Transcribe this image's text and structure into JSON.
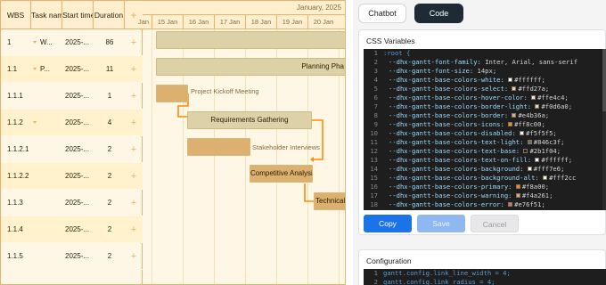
{
  "gantt": {
    "month_label": "January, 2025",
    "columns": {
      "wbs": "WBS",
      "task": "Task name",
      "start": "Start time",
      "duration": "Duration",
      "add": "+"
    },
    "days": [
      "Jan",
      "15 Jan",
      "16 Jan",
      "17 Jan",
      "18 Jan",
      "19 Jan",
      "20 Jan"
    ],
    "rows": [
      {
        "wbs": "1",
        "task": "W...",
        "start": "2025-...",
        "duration": "86",
        "caret": true
      },
      {
        "wbs": "1.1",
        "task": "P...",
        "start": "2025-...",
        "duration": "11",
        "caret": true
      },
      {
        "wbs": "1.1.1",
        "task": "",
        "start": "2025-...",
        "duration": "1",
        "caret": false
      },
      {
        "wbs": "1.1.2",
        "task": "",
        "start": "2025-...",
        "duration": "4",
        "caret": true
      },
      {
        "wbs": "1.1.2.1",
        "task": "",
        "start": "2025-...",
        "duration": "2",
        "caret": false
      },
      {
        "wbs": "1.1.2.2",
        "task": "",
        "start": "2025-...",
        "duration": "2",
        "caret": false
      },
      {
        "wbs": "1.1.3",
        "task": "",
        "start": "2025-...",
        "duration": "2",
        "caret": false
      },
      {
        "wbs": "1.1.4",
        "task": "",
        "start": "2025-...",
        "duration": "2",
        "caret": false
      },
      {
        "wbs": "1.1.5",
        "task": "",
        "start": "2025-...",
        "duration": "2",
        "caret": false
      }
    ],
    "bars": {
      "planning": "Planning Pha",
      "kickoff": "Project Kickoff Meeting",
      "requirements": "Requirements Gathering",
      "interviews": "Stakeholder Interviews",
      "competitive": "Competitive Analysis",
      "technical": "Technical A"
    }
  },
  "panel": {
    "tabs": {
      "chatbot": "Chatbot",
      "code": "Code"
    },
    "css_title": "CSS Variables",
    "config_title": "Configuration",
    "buttons": {
      "copy": "Copy",
      "save": "Save",
      "cancel": "Cancel"
    },
    "css_lines": [
      {
        "n": "1",
        "text": ":root {"
      },
      {
        "n": "2",
        "prop": "--dhx-gantt-font-family:",
        "val": "Inter, Arial, sans-serif"
      },
      {
        "n": "3",
        "prop": "--dhx-gantt-font-size:",
        "val": "14px;"
      },
      {
        "n": "4",
        "prop": "--dhx-gantt-base-colors-white:",
        "val": "#ffffff;",
        "color": "#ffffff"
      },
      {
        "n": "5",
        "prop": "--dhx-gantt-base-colors-select:",
        "val": "#ffd27a;",
        "color": "#ffd27a"
      },
      {
        "n": "6",
        "prop": "--dhx-gantt-base-colors-hover-color:",
        "val": "#ffe4c4;",
        "color": "#ffe4c4"
      },
      {
        "n": "7",
        "prop": "--dhx-gantt-base-colors-border-light:",
        "val": "#f0d6a0;",
        "color": "#f0d6a0"
      },
      {
        "n": "8",
        "prop": "--dhx-gantt-base-colors-border:",
        "val": "#e4b36a;",
        "color": "#e4b36a"
      },
      {
        "n": "9",
        "prop": "--dhx-gantt-base-colors-icons:",
        "val": "#ff8c00;",
        "color": "#ff8c00"
      },
      {
        "n": "10",
        "prop": "--dhx-gantt-base-colors-disabled:",
        "val": "#f5f5f5;",
        "color": "#f5f5f5"
      },
      {
        "n": "11",
        "prop": "--dhx-gantt-base-colors-text-light:",
        "val": "#846c3f;",
        "color": "#846c3f"
      },
      {
        "n": "12",
        "prop": "--dhx-gantt-base-colors-text-base:",
        "val": "#2b1f04;",
        "color": "#2b1f04"
      },
      {
        "n": "13",
        "prop": "--dhx-gantt-base-colors-text-on-fill:",
        "val": "#ffffff;",
        "color": "#ffffff"
      },
      {
        "n": "14",
        "prop": "--dhx-gantt-base-colors-background:",
        "val": "#fff7e6;",
        "color": "#fff7e6"
      },
      {
        "n": "15",
        "prop": "--dhx-gantt-base-colors-background-alt:",
        "val": "#fff2cc",
        "color": "#fff2cc"
      },
      {
        "n": "16",
        "prop": "--dhx-gantt-base-colors-primary:",
        "val": "#f8a00;",
        "color": "#ff8a00"
      },
      {
        "n": "17",
        "prop": "--dhx-gantt-base-colors-warning:",
        "val": "#f4a261;",
        "color": "#f4a261"
      },
      {
        "n": "18",
        "prop": "--dhx-gantt-base-colors-error:",
        "val": "#e76f51;",
        "color": "#e76f51"
      }
    ],
    "config_lines": [
      {
        "n": "1",
        "text": "gantt.config.link_line_width = 4;"
      },
      {
        "n": "2",
        "text": "gantt.config.link_radius = 4;"
      }
    ]
  }
}
